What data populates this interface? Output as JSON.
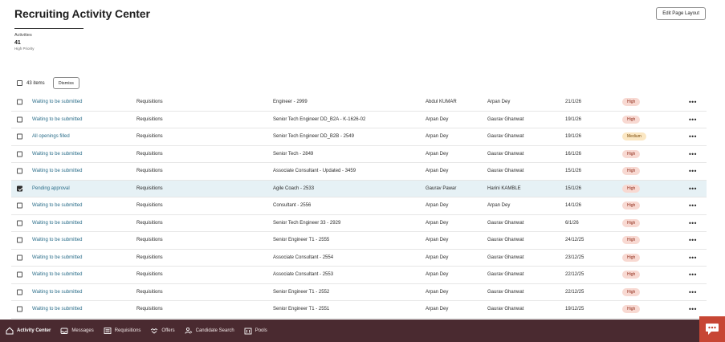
{
  "page": {
    "title": "Recruiting Activity Center",
    "edit_layout_label": "Edit Page Layout"
  },
  "summary": {
    "label": "Activities",
    "count": "41",
    "sublabel": "High Priority"
  },
  "bulk": {
    "items_label": "43 items",
    "dismiss_label": "Dismiss"
  },
  "rows": [
    {
      "status": "Waiting to be submitted",
      "type": "Requisitions",
      "title": "Engineer - 2999",
      "person1": "Abdul KUMAR",
      "person2": "Arpan Dey",
      "date": "21/1/26",
      "priority": "High",
      "checked": false
    },
    {
      "status": "Waiting to be submitted",
      "type": "Requisitions",
      "title": "Senior Tech Engineer DD_B2A - K-1626-02",
      "person1": "Arpan Dey",
      "person2": "Gaurav Ghanwat",
      "date": "19/1/26",
      "priority": "High",
      "checked": false
    },
    {
      "status": "All openings filled",
      "type": "Requisitions",
      "title": "Senior Tech Engineer DD_B2B - 2549",
      "person1": "Arpan Dey",
      "person2": "Gaurav Ghanwat",
      "date": "19/1/26",
      "priority": "Medium",
      "checked": false
    },
    {
      "status": "Waiting to be submitted",
      "type": "Requisitions",
      "title": "Senior Tech - 2849",
      "person1": "Arpan Dey",
      "person2": "Gaurav Ghanwat",
      "date": "16/1/26",
      "priority": "High",
      "checked": false
    },
    {
      "status": "Waiting to be submitted",
      "type": "Requisitions",
      "title": "Associate Consultant - Updated - 3459",
      "person1": "Arpan Dey",
      "person2": "Gaurav Ghanwat",
      "date": "15/1/26",
      "priority": "High",
      "checked": false
    },
    {
      "status": "Pending approval",
      "type": "Requisitions",
      "title": "Agile Coach - 2533",
      "person1": "Gaurav Pawar",
      "person2": "Harini KAMBLE",
      "date": "15/1/26",
      "priority": "High",
      "checked": true
    },
    {
      "status": "Waiting to be submitted",
      "type": "Requisitions",
      "title": "Consultant - 2556",
      "person1": "Arpan Dey",
      "person2": "Arpan Dey",
      "date": "14/1/26",
      "priority": "High",
      "checked": false
    },
    {
      "status": "Waiting to be submitted",
      "type": "Requisitions",
      "title": "Senior Tech Engineer 33 - 2929",
      "person1": "Arpan Dey",
      "person2": "Gaurav Ghanwat",
      "date": "6/1/26",
      "priority": "High",
      "checked": false
    },
    {
      "status": "Waiting to be submitted",
      "type": "Requisitions",
      "title": "Senior Engineer T1 - 2555",
      "person1": "Arpan Dey",
      "person2": "Gaurav Ghanwat",
      "date": "24/12/25",
      "priority": "High",
      "checked": false
    },
    {
      "status": "Waiting to be submitted",
      "type": "Requisitions",
      "title": "Associate Consultant - 2554",
      "person1": "Arpan Dey",
      "person2": "Gaurav Ghanwat",
      "date": "23/12/25",
      "priority": "High",
      "checked": false
    },
    {
      "status": "Waiting to be submitted",
      "type": "Requisitions",
      "title": "Associate Consultant - 2553",
      "person1": "Arpan Dey",
      "person2": "Gaurav Ghanwat",
      "date": "22/12/25",
      "priority": "High",
      "checked": false
    },
    {
      "status": "Waiting to be submitted",
      "type": "Requisitions",
      "title": "Senior Engineer T1 - 2552",
      "person1": "Arpan Dey",
      "person2": "Gaurav Ghanwat",
      "date": "22/12/25",
      "priority": "High",
      "checked": false
    },
    {
      "status": "Waiting to be submitted",
      "type": "Requisitions",
      "title": "Senior Engineer T1 - 2551",
      "person1": "Arpan Dey",
      "person2": "Gaurav Ghanwat",
      "date": "19/12/25",
      "priority": "High",
      "checked": false
    }
  ],
  "more_glyph": "•••",
  "nav": [
    {
      "label": "Activity Center",
      "icon": "home-icon",
      "active": true
    },
    {
      "label": "Messages",
      "icon": "inbox-icon",
      "active": false
    },
    {
      "label": "Requisitions",
      "icon": "list-icon",
      "active": false
    },
    {
      "label": "Offers",
      "icon": "handshake-icon",
      "active": false
    },
    {
      "label": "Candidate Search",
      "icon": "person-search-icon",
      "active": false
    },
    {
      "label": "Pools",
      "icon": "pools-icon",
      "active": false
    }
  ],
  "chat": {
    "icon": "chat-icon"
  },
  "colors": {
    "bottom_bar": "#4a2a30",
    "chat_button": "#c74634",
    "link": "#2b6e8a",
    "selected_row": "#e6f1f5"
  }
}
